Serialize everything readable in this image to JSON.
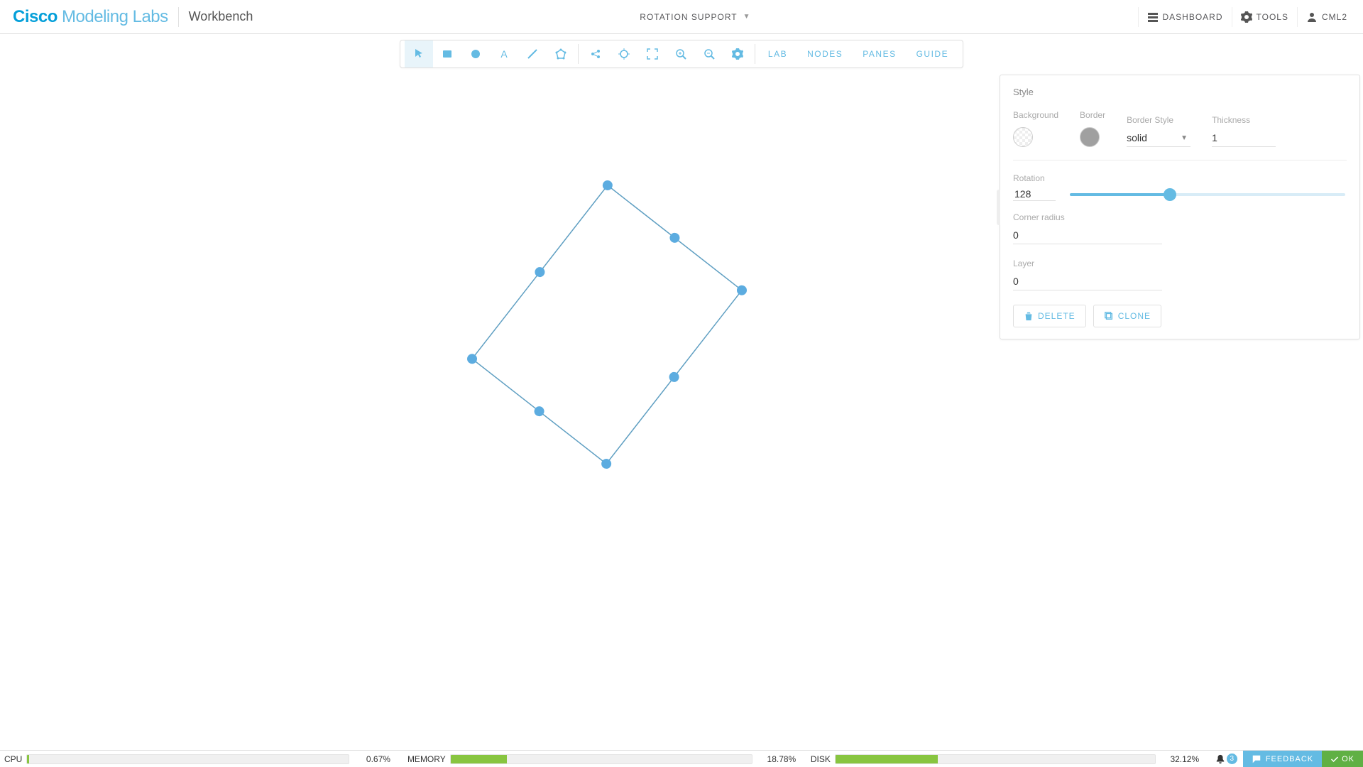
{
  "header": {
    "brand1": "Cisco",
    "brand2": "Modeling Labs",
    "section": "Workbench",
    "project": "ROTATION SUPPORT",
    "dashboard": "DASHBOARD",
    "tools": "TOOLS",
    "user": "CML2"
  },
  "toolbar": {
    "tabs": [
      "LAB",
      "NODES",
      "PANES",
      "GUIDE"
    ]
  },
  "panel": {
    "title": "Style",
    "background_label": "Background",
    "border_label": "Border",
    "border_style_label": "Border Style",
    "border_style_value": "solid",
    "thickness_label": "Thickness",
    "thickness_value": "1",
    "rotation_label": "Rotation",
    "rotation_value": "128",
    "corner_label": "Corner radius",
    "corner_value": "0",
    "layer_label": "Layer",
    "layer_value": "0",
    "delete_label": "DELETE",
    "clone_label": "CLONE"
  },
  "status": {
    "cpu_label": "CPU",
    "cpu_pct": "0.67%",
    "cpu_fill": 0.67,
    "mem_label": "MEMORY",
    "mem_pct": "18.78%",
    "mem_fill": 18.78,
    "disk_label": "DISK",
    "disk_pct": "32.12%",
    "disk_fill": 32.12,
    "notif_count": "3",
    "feedback": "FEEDBACK",
    "ok": "OK"
  },
  "shape": {
    "rotation_deg": 128
  }
}
